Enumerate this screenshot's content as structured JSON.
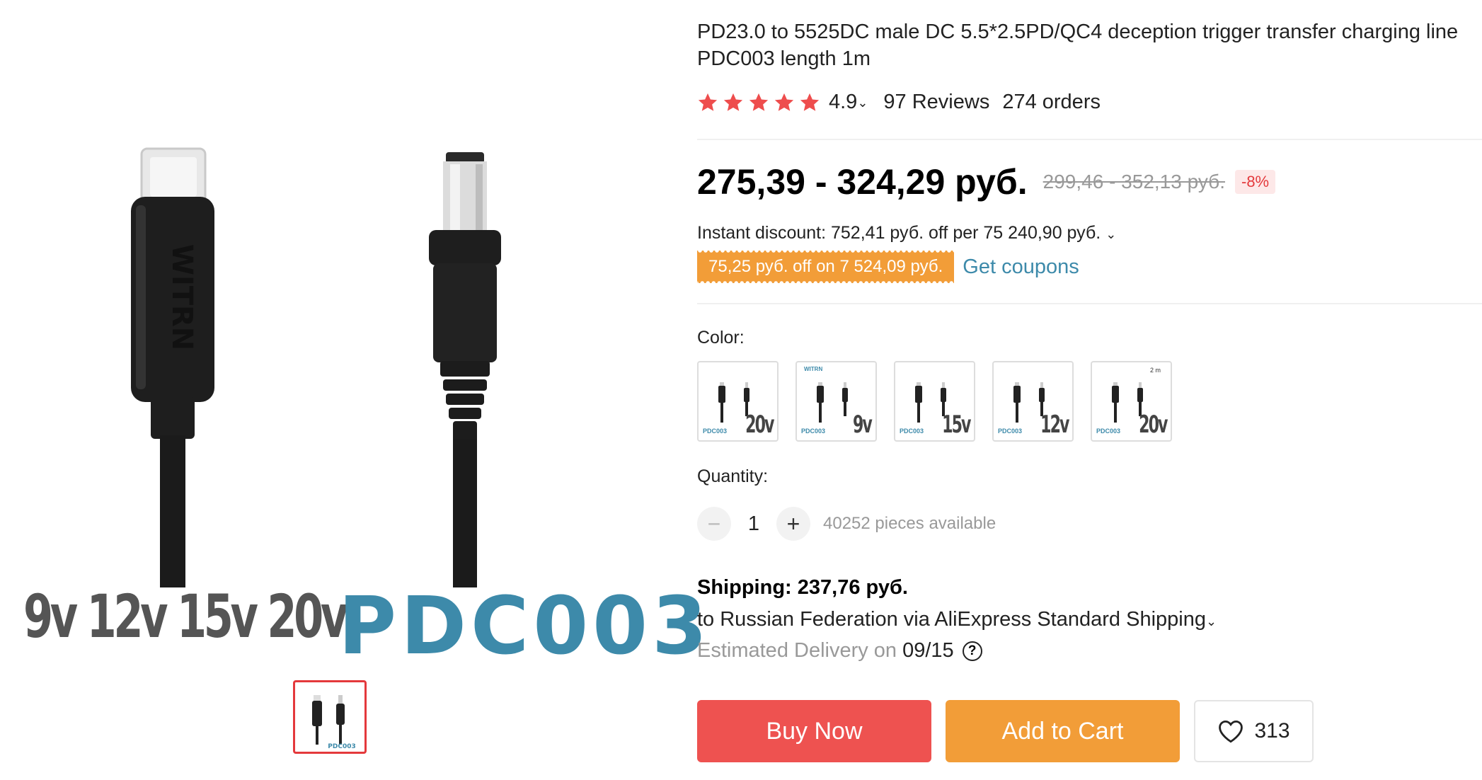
{
  "gallery": {
    "image_texts": {
      "brand": "WITRN",
      "voltages": "9v 12v 15v 20v",
      "model": "PDC003"
    },
    "thumbnails": [
      {
        "label": "PDC003"
      }
    ]
  },
  "product": {
    "title": "PD23.0 to 5525DC male DC 5.5*2.5PD/QC4 deception trigger transfer charging line PDC003 length 1m",
    "rating": {
      "stars": 5,
      "value": "4.9",
      "reviews": "97 Reviews",
      "orders": "274 orders",
      "star_color": "#ee4d4d"
    }
  },
  "price": {
    "current": "275,39 - 324,29 руб.",
    "original": "299,46 - 352,13 руб.",
    "discount": "-8%",
    "instant_discount": "Instant discount: 752,41 руб. off per 75 240,90 руб.",
    "coupon": "75,25 руб. off on 7 524,09 руб.",
    "get_coupons": "Get coupons"
  },
  "color": {
    "label": "Color:",
    "options": [
      {
        "voltage": "20v",
        "model": "PDC003",
        "extra": ""
      },
      {
        "voltage": "9v",
        "model": "PDC003",
        "extra": "WITRN"
      },
      {
        "voltage": "15v",
        "model": "PDC003",
        "extra": ""
      },
      {
        "voltage": "12v",
        "model": "PDC003",
        "extra": ""
      },
      {
        "voltage": "20v",
        "model": "PDC003",
        "extra": "2 m"
      }
    ]
  },
  "quantity": {
    "label": "Quantity:",
    "value": "1",
    "minus": "−",
    "plus": "+",
    "available": "40252 pieces available"
  },
  "shipping": {
    "label": "Shipping:",
    "cost": "237,76 руб.",
    "method": "to Russian Federation via AliExpress Standard Shipping",
    "estimated_label": "Estimated Delivery on",
    "date": "09/15",
    "help": "?"
  },
  "actions": {
    "buy_now": "Buy Now",
    "add_to_cart": "Add to Cart",
    "wishlist_count": "313",
    "buy_color": "#ee5250",
    "cart_color": "#f29d38"
  }
}
